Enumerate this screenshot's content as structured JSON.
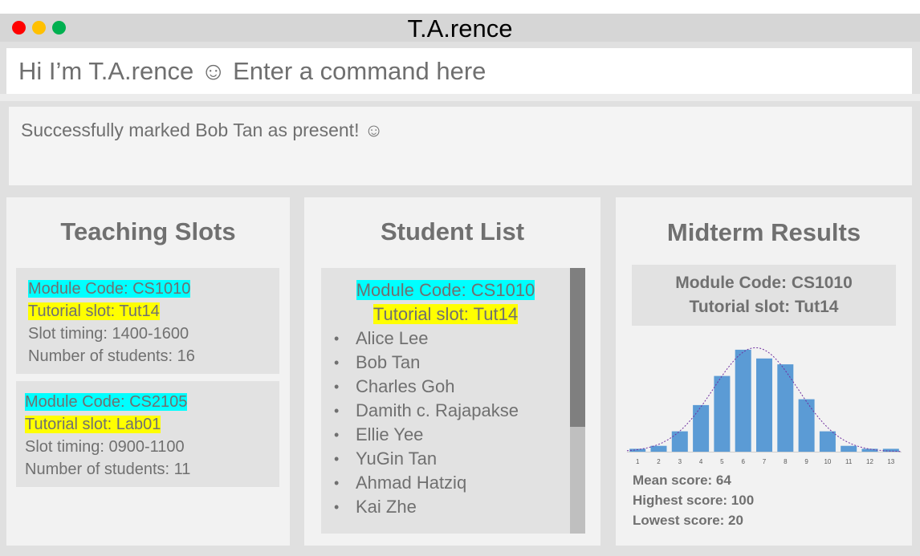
{
  "window": {
    "title": "T.A.rence",
    "controls": {
      "close_color": "#ff0000",
      "minimize_color": "#ffc000",
      "maximize_color": "#00b050"
    }
  },
  "command": {
    "placeholder": "Hi I’m T.A.rence ☺ Enter a command here",
    "value": ""
  },
  "result": {
    "message": "Successfully marked Bob Tan as present! ☺"
  },
  "teaching_slots": {
    "title": "Teaching Slots",
    "slots": [
      {
        "module": "Module Code: CS1010",
        "tutorial": "Tutorial slot: Tut14",
        "timing": "Slot timing: 1400-1600",
        "students": "Number of students: 16"
      },
      {
        "module": "Module Code: CS2105",
        "tutorial": "Tutorial slot: Lab01",
        "timing": "Slot timing: 0900-1100",
        "students": "Number of students: 11"
      }
    ]
  },
  "student_list": {
    "title": "Student List",
    "module": "Module Code: CS1010",
    "tutorial": "Tutorial slot: Tut14",
    "students": [
      "Alice Lee",
      "Bob Tan",
      "Charles Goh",
      "Damith c. Rajapakse",
      "Ellie Yee",
      "YuGin Tan",
      "Ahmad Hatziq",
      "Kai Zhe"
    ],
    "scroll_position": 0
  },
  "midterm_results": {
    "title": "Midterm Results",
    "module": "Module Code: CS1010",
    "tutorial": "Tutorial slot: Tut14",
    "stats": {
      "mean": "Mean score: 64",
      "highest": "Highest score: 100",
      "lowest": "Lowest score: 20"
    }
  },
  "colors": {
    "highlight_module": "#00ffff",
    "highlight_tutorial": "#ffff00",
    "bar": "#5b9bd5",
    "curve": "#7030a0"
  },
  "chart_data": {
    "type": "bar",
    "categories": [
      "1",
      "2",
      "3",
      "4",
      "5",
      "6",
      "7",
      "8",
      "9",
      "10",
      "11",
      "12",
      "13"
    ],
    "values": [
      1,
      2,
      7,
      16,
      26,
      35,
      32,
      30,
      18,
      7,
      2,
      1,
      1
    ],
    "ylim": [
      0,
      38
    ],
    "overlay": "normal-curve",
    "grid": false,
    "legend": "none"
  }
}
